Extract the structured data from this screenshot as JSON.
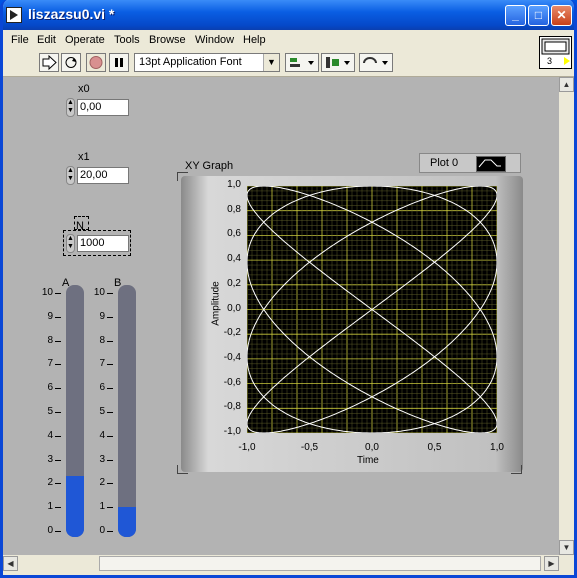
{
  "window": {
    "title": "liszazsu0.vi *"
  },
  "menu": [
    "File",
    "Edit",
    "Operate",
    "Tools",
    "Browse",
    "Window",
    "Help"
  ],
  "toolbar": {
    "font": "13pt Application Font"
  },
  "vi_icon": {
    "connector_number": "3"
  },
  "controls": {
    "x0": {
      "label": "x0",
      "value": "0,00"
    },
    "x1": {
      "label": "x1",
      "value": "20,00"
    },
    "N": {
      "label": "N",
      "value": "1000"
    }
  },
  "tanks": {
    "A": {
      "label": "A",
      "scale": [
        "10",
        "9",
        "8",
        "7",
        "6",
        "5",
        "4",
        "3",
        "2",
        "1",
        "0"
      ],
      "level": 2.3,
      "max": 10
    },
    "B": {
      "label": "B",
      "scale": [
        "10",
        "9",
        "8",
        "7",
        "6",
        "5",
        "4",
        "3",
        "2",
        "1",
        "0"
      ],
      "level": 1.0,
      "max": 10
    }
  },
  "graph": {
    "label": "XY Graph",
    "legend": "Plot 0",
    "ylabel": "Amplitude",
    "xlabel": "Time",
    "yticks": [
      "1,0",
      "0,8",
      "0,6",
      "0,4",
      "0,2",
      "0,0",
      "-0,2",
      "-0,4",
      "-0,6",
      "-0,8",
      "-1,0"
    ],
    "xticks": [
      "-1,0",
      "-0,5",
      "0,0",
      "0,5",
      "1,0"
    ]
  },
  "colors": {
    "panel": "#b3b3b3",
    "plot_bg": "#000000",
    "grid_major": "#c8c83c",
    "grid_minor": "#5a5a28",
    "trace": "#ffffff",
    "tank_fill": "#1f57d6",
    "tank_empty": "#6e7080"
  },
  "chart_data": {
    "type": "line",
    "title": "XY Graph",
    "xlabel": "Time",
    "ylabel": "Amplitude",
    "xlim": [
      -1,
      1
    ],
    "ylim": [
      -1,
      1
    ],
    "series": [
      {
        "name": "Plot 0",
        "curve": "lissajous",
        "x_freq": 4,
        "y_freq": 3
      }
    ]
  }
}
